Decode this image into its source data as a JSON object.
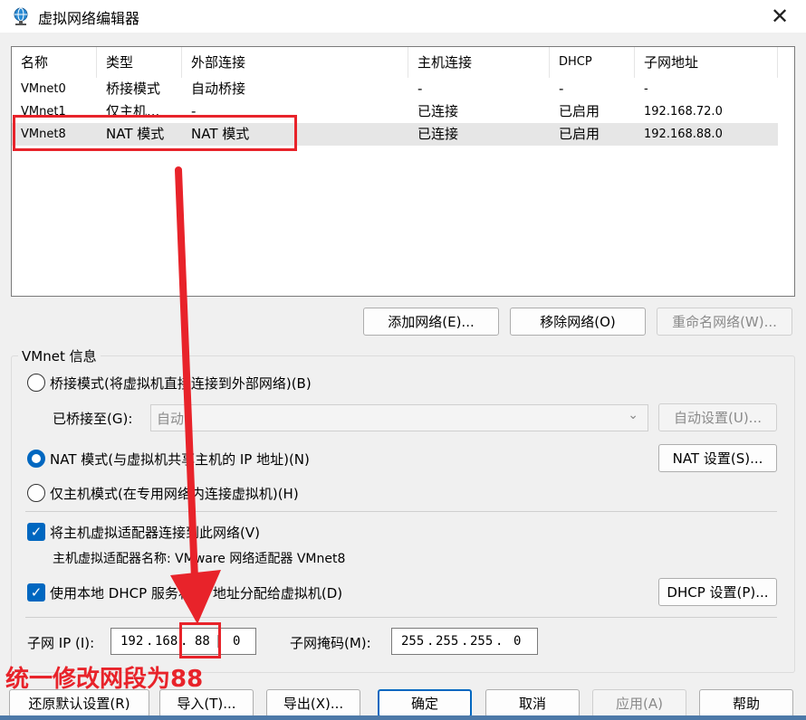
{
  "window": {
    "title": "虚拟网络编辑器",
    "close_glyph": "✕"
  },
  "network_list": {
    "columns": [
      "名称",
      "类型",
      "外部连接",
      "主机连接",
      "DHCP",
      "子网地址"
    ],
    "rows": [
      {
        "name": "VMnet0",
        "type": "桥接模式",
        "external": "自动桥接",
        "host": "-",
        "dhcp": "-",
        "subnet": "-"
      },
      {
        "name": "VMnet1",
        "type": "仅主机...",
        "external": "-",
        "host": "已连接",
        "dhcp": "已启用",
        "subnet": "192.168.72.0"
      },
      {
        "name": "VMnet8",
        "type": "NAT 模式",
        "external": "NAT 模式",
        "host": "已连接",
        "dhcp": "已启用",
        "subnet": "192.168.88.0"
      }
    ],
    "selected_row": "VMnet8"
  },
  "list_buttons": {
    "add": "添加网络(E)...",
    "remove": "移除网络(O)",
    "rename": "重命名网络(W)..."
  },
  "vmnet_info": {
    "group_title": "VMnet 信息",
    "bridge_radio": "桥接模式(将虚拟机直接连接到外部网络)(B)",
    "bridged_to_label": "已桥接至(G):",
    "bridged_to_value": "自动",
    "auto_settings": "自动设置(U)...",
    "nat_radio": "NAT 模式(与虚拟机共享主机的 IP 地址)(N)",
    "nat_settings": "NAT 设置(S)...",
    "hostonly_radio": "仅主机模式(在专用网络内连接虚拟机)(H)",
    "connect_adapter_checkbox": "将主机虚拟适配器连接到此网络(V)",
    "adapter_name_label": "主机虚拟适配器名称: VMware 网络适配器 VMnet8",
    "dhcp_checkbox": "使用本地 DHCP 服务将 IP 地址分配给虚拟机(D)",
    "dhcp_settings": "DHCP 设置(P)...",
    "selected_mode": "nat",
    "connect_adapter_checked": true,
    "dhcp_checked": true
  },
  "subnet": {
    "ip_label": "子网 IP (I):",
    "ip_octets": [
      "192",
      "168",
      "88",
      "0"
    ],
    "mask_label": "子网掩码(M):",
    "mask_octets": [
      "255",
      "255",
      "255",
      "0"
    ]
  },
  "annotation": {
    "text": "统一修改网段为88",
    "color": "#e8232a"
  },
  "footer_buttons": {
    "restore": "还原默认设置(R)",
    "import": "导入(T)...",
    "export": "导出(X)...",
    "ok": "确定",
    "cancel": "取消",
    "apply": "应用(A)",
    "help": "帮助"
  },
  "colors": {
    "accent": "#0067c0",
    "selected_row": "#e6e6e6",
    "annotation": "#e8232a"
  }
}
